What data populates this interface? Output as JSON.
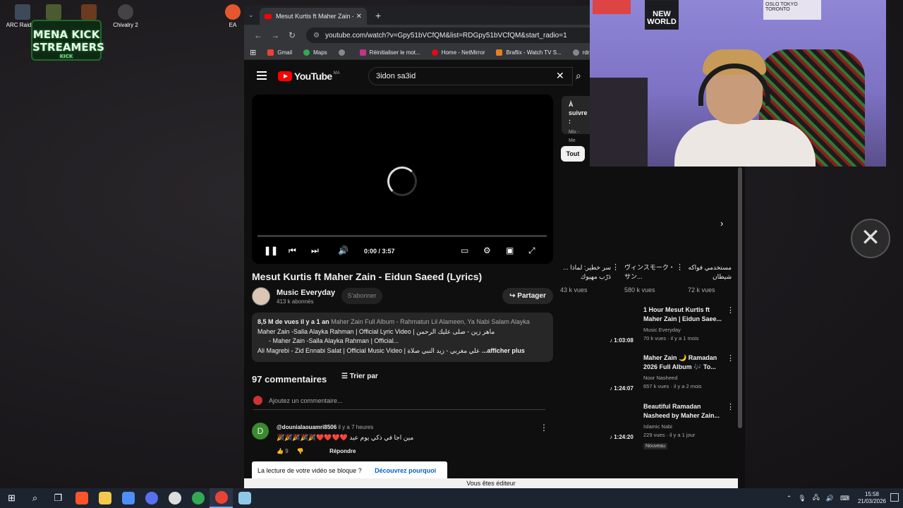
{
  "desktop": {
    "icons": [
      {
        "label": "ARC Raiders",
        "color": "#3d4a5a"
      },
      {
        "label": "",
        "color": "#4b5b2f"
      },
      {
        "label": "",
        "color": "#6b3a1f"
      },
      {
        "label": "Chivalry 2",
        "color": "#444444"
      },
      {
        "label": "EA",
        "color": "#e4572e"
      }
    ],
    "overlay_logo": {
      "line1": "MENA KICK",
      "line2": "STREAMERS",
      "sub": "KICK"
    }
  },
  "browser": {
    "tab_title": "Mesut Kurtis ft Maher Zain - Ei",
    "url": "youtube.com/watch?v=Gpy51bVCfQM&list=RDGpy51bVCfQM&start_radio=1",
    "bookmarks": [
      {
        "label": "Gmail",
        "color": "#ea4335"
      },
      {
        "label": "Maps",
        "color": "#34a853"
      },
      {
        "label": "",
        "color": "#888888"
      },
      {
        "label": "Réinitialiser le mot...",
        "color": "#c13584"
      },
      {
        "label": "Home - NetMirror",
        "color": "#e50914"
      },
      {
        "label": "Braflix - Watch TV S...",
        "color": "#e67e22"
      },
      {
        "label": "rdr2",
        "color": "#888888"
      }
    ]
  },
  "youtube": {
    "logo_word": "YouTube",
    "logo_country": "MA",
    "search_value": "3idon sa3id",
    "player": {
      "time": "0:00 / 3:57",
      "progress": 0
    },
    "video_title": "Mesut Kurtis ft Maher Zain - Eidun Saeed (Lyrics)",
    "channel": {
      "name": "Music Everyday",
      "subs": "413 k abonnés",
      "subscribe": "S'abonner"
    },
    "share_label": "Partager",
    "description": {
      "views": "8,5 M de vues",
      "age": "il y a 1 an",
      "tags": "Maher Zain Full Album  - Rahmatun Lil Alameen, Ya Nabi Salam Alayka",
      "line2": "Maher Zain -Salla Alayka Rahman | Official Lyric Video | ماهر زين - صلى عليك الرحمن",
      "line3": "- Maher Zain -Salla Alayka Rahman | Official...",
      "line4": "Ali Magrebi - Zid Ennabi Salat | Official Music Video | علي مغربي - زيد النبي صلاة",
      "more": "...afficher plus"
    },
    "comments": {
      "count_label": "97 commentaires",
      "sort_label": "Trier par",
      "add_placeholder": "Ajoutez un commentaire...",
      "items": [
        {
          "avatar": "D",
          "user": "@dounialaouamri8506",
          "ago": "il y a 7 heures",
          "text": "🎉🎉🎉🎉🎉❤️❤️❤️❤️ مين اجا في ذكي يوم عيد",
          "likes": "9",
          "reply": "Répondre"
        }
      ]
    },
    "toast": {
      "text": "La lecture de votre vidéo se bloque ?",
      "link": "Découvrez pourquoi"
    },
    "editor_bar": "Vous êtes éditeur",
    "up_next": {
      "line1": "À",
      "line2": "suivre :",
      "mix": "Mix - Me"
    },
    "chip": "Tout",
    "shelf": [
      {
        "title": "سر خطير: لماذا ... دَرّب مهيوك",
        "views": "43 k vues"
      },
      {
        "title": "ヴィンスモーク・サン...",
        "views": "580 k vues"
      },
      {
        "title": "مستخدمي فواكه شيطان استطاع...",
        "views": "72 k vues"
      }
    ],
    "recommendations": [
      {
        "title": "1 Hour Mesut Kurtis ft Maher Zain | Eidun Saee...",
        "channel": "Music Everyday",
        "meta": "70 k vues · il y a 1 mois",
        "duration": "1:03:08",
        "badge": ""
      },
      {
        "title": "Maher Zain 🌙 Ramadan 2026 Full Album 🎶 To...",
        "channel": "Noor Nasheed",
        "meta": "657 k vues · il y a 2 mois",
        "duration": "1:24:07",
        "badge": ""
      },
      {
        "title": "Beautiful Ramadan Nasheed by Maher Zain...",
        "channel": "Islamic Nabi",
        "meta": "229 vues · il y a 1 jour",
        "duration": "1:24:20",
        "badge": "Nouveau"
      }
    ]
  },
  "webcam": {
    "poster_text": "NEW WORLD",
    "poster3_text": "OSLO TOKYO TORONTO"
  },
  "taskbar": {
    "apps": [
      {
        "name": "brave",
        "color": "#fb542b"
      },
      {
        "name": "explorer",
        "color": "#f2c94c"
      },
      {
        "name": "calculator",
        "color": "#4f8ef7"
      },
      {
        "name": "app-blue",
        "color": "#5a6ef0"
      },
      {
        "name": "app-github",
        "color": "#dddddd"
      },
      {
        "name": "chrome",
        "color": "#34a853"
      },
      {
        "name": "chrome-active",
        "color": "#ea4335"
      },
      {
        "name": "notepad",
        "color": "#8ecae6"
      }
    ],
    "time": "15:58",
    "date": "21/03/2026"
  }
}
